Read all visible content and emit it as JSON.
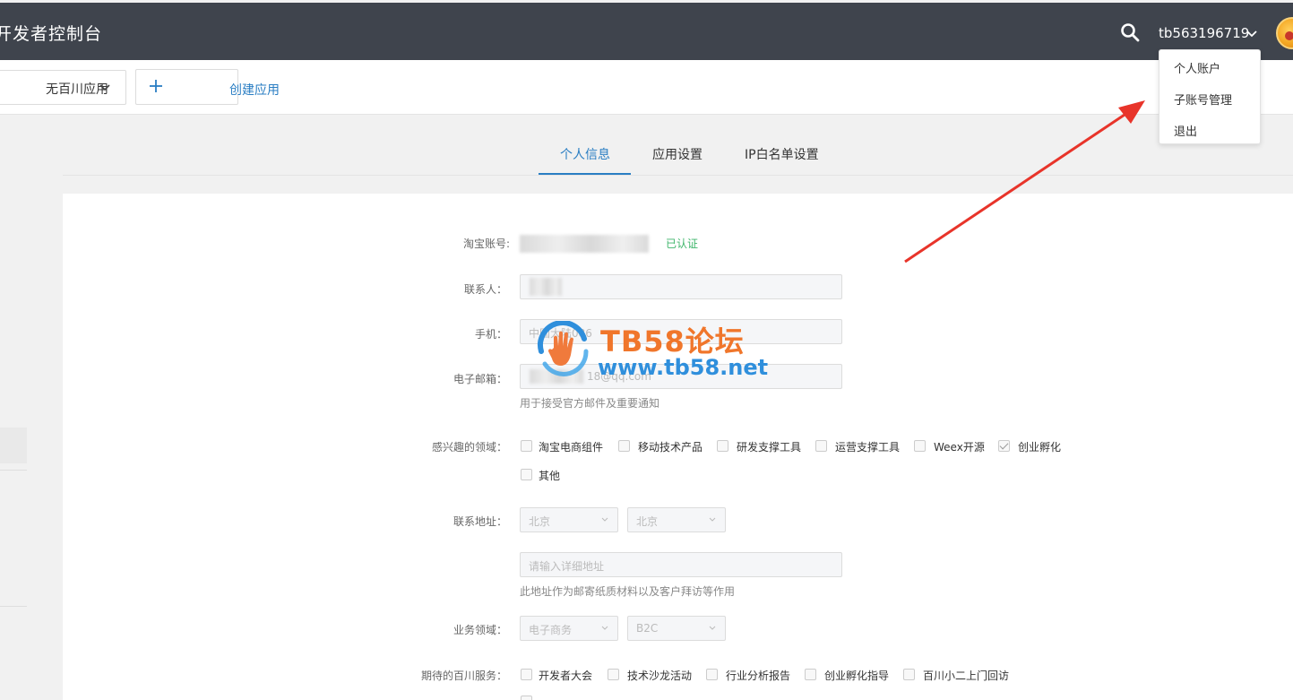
{
  "header": {
    "title": "开发者控制台",
    "username": "tb563196719"
  },
  "appbar": {
    "app_select_label": "无百川应用",
    "create_label": "创建应用"
  },
  "tabs": [
    {
      "label": "个人信息",
      "active": true
    },
    {
      "label": "应用设置",
      "active": false
    },
    {
      "label": "IP白名单设置",
      "active": false
    }
  ],
  "user_menu": {
    "items": [
      "个人账户",
      "子账号管理",
      "退出"
    ]
  },
  "form": {
    "taobao_account": {
      "label": "淘宝账号:",
      "status": "已认证"
    },
    "contact": {
      "label": "联系人："
    },
    "phone": {
      "label": "手机：",
      "value": "中国大陆086"
    },
    "email": {
      "label": "电子邮箱：",
      "value": "18@qq.com",
      "hint": "用于接受官方邮件及重要通知"
    },
    "interests": {
      "label": "感兴趣的领域：",
      "options": [
        {
          "label": "淘宝电商组件",
          "checked": false
        },
        {
          "label": "移动技术产品",
          "checked": false
        },
        {
          "label": "研发支撑工具",
          "checked": false
        },
        {
          "label": "运营支撑工具",
          "checked": false
        },
        {
          "label": "Weex开源",
          "checked": false
        },
        {
          "label": "创业孵化",
          "checked": true
        },
        {
          "label": "其他",
          "checked": false
        }
      ]
    },
    "address": {
      "label": "联系地址：",
      "province": "北京",
      "city": "北京",
      "detail_placeholder": "请输入详细地址",
      "hint": "此地址作为邮寄纸质材料以及客户拜访等作用"
    },
    "business": {
      "label": "业务领域：",
      "domain": "电子商务",
      "model": "B2C"
    },
    "services": {
      "label": "期待的百川服务：",
      "options": [
        {
          "label": "开发者大会",
          "checked": false
        },
        {
          "label": "技术沙龙活动",
          "checked": false
        },
        {
          "label": "行业分析报告",
          "checked": false
        },
        {
          "label": "创业孵化指导",
          "checked": false
        },
        {
          "label": "百川小二上门回访",
          "checked": false
        }
      ]
    }
  },
  "watermark": {
    "title": "TB58论坛",
    "url": "www.tb58.net"
  },
  "colors": {
    "header_bg": "#3f444d",
    "accent": "#2a7ec3",
    "verified": "#3fb66b",
    "annotation_arrow": "#e8342a"
  }
}
